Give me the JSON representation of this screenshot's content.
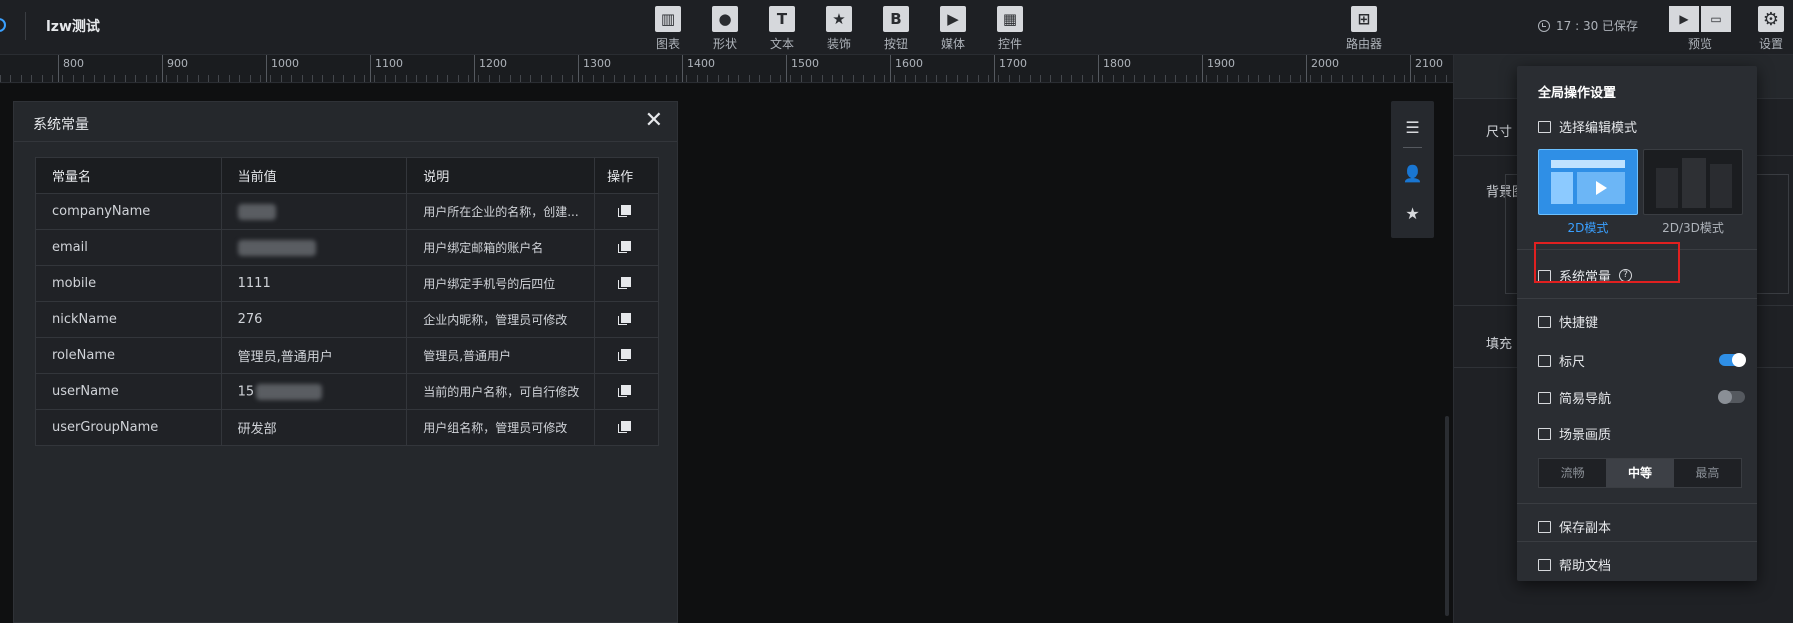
{
  "app": {
    "project_title": "lzw测试",
    "save_status": "17 : 30 已保存"
  },
  "toolbar": {
    "tools": [
      {
        "label": "图表",
        "glyph": "▥"
      },
      {
        "label": "形状",
        "glyph": "●"
      },
      {
        "label": "文本",
        "glyph": "T"
      },
      {
        "label": "装饰",
        "glyph": "★"
      },
      {
        "label": "按钮",
        "glyph": "B"
      },
      {
        "label": "媒体",
        "glyph": "▶"
      },
      {
        "label": "控件",
        "glyph": "▦"
      }
    ],
    "router": {
      "label": "路由器",
      "glyph": "⊞"
    },
    "preview_label": "预览",
    "settings_label": "设置"
  },
  "ruler": {
    "ticks": [
      "800",
      "900",
      "1000",
      "1100",
      "1200",
      "1300",
      "1400",
      "1500",
      "1600",
      "1700",
      "1800",
      "1900",
      "2000",
      "2100"
    ]
  },
  "modal": {
    "title": "系统常量",
    "columns": [
      "常量名",
      "当前值",
      "说明",
      "操作"
    ],
    "rows": [
      {
        "name": "companyName",
        "value": "",
        "desc": "用户所在企业的名称，创建..."
      },
      {
        "name": "email",
        "value": "",
        "desc": "用户绑定邮箱的账户名"
      },
      {
        "name": "mobile",
        "value": "1111",
        "desc": "用户绑定手机号的后四位"
      },
      {
        "name": "nickName",
        "value": "276",
        "desc": "企业内昵称，管理员可修改"
      },
      {
        "name": "roleName",
        "value": "管理员,普通用户",
        "desc": "管理员,普通用户"
      },
      {
        "name": "userName",
        "value": "15",
        "desc": "当前的用户名称，可自行修改"
      },
      {
        "name": "userGroupName",
        "value": "研发部",
        "desc": "用户组名称，管理员可修改"
      }
    ]
  },
  "right_panel": {
    "size_label": "尺寸",
    "bg_label": "背景图",
    "fill_label": "填充"
  },
  "dropdown": {
    "title": "全局操作设置",
    "edit_mode_label": "选择编辑模式",
    "mode_2d": "2D模式",
    "mode_3d": "2D/3D模式",
    "system_constants": "系统常量",
    "shortcuts": "快捷键",
    "ruler": "标尺",
    "ruler_on": true,
    "simple_nav": "简易导航",
    "simple_nav_on": false,
    "scene_quality": "场景画质",
    "quality_options": [
      "流畅",
      "中等",
      "最高"
    ],
    "quality_selected": "中等",
    "save_copy": "保存副本",
    "help_docs": "帮助文档"
  },
  "colors": {
    "accent": "#2f8fe6",
    "highlight": "#e02020",
    "toggle_on": "#2f8fe6"
  }
}
